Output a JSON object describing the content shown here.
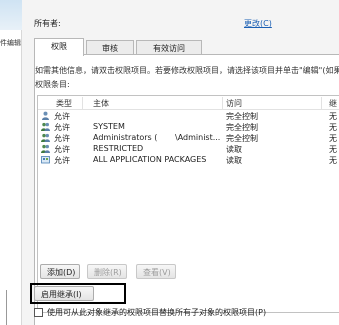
{
  "left_panel": {
    "fragment": "件编辑"
  },
  "owner": {
    "label": "所有者:",
    "change_link": "更改(C)"
  },
  "tabs": [
    {
      "label": "权限",
      "active": true
    },
    {
      "label": "审核",
      "active": false
    },
    {
      "label": "有效访问",
      "active": false
    }
  ],
  "permissions": {
    "description": "如需其他信息，请双击权限项目。若要修改权限项目，请选择该项目并单击\"编辑\"(如果",
    "entries_label": "权限条目:",
    "columns": {
      "type": "类型",
      "principal": "主体",
      "access": "访问",
      "inherited": "继"
    },
    "rows": [
      {
        "icon": "user-icon",
        "type": "允许",
        "principal": "",
        "access": "完全控制",
        "inherited": "无"
      },
      {
        "icon": "group-icon",
        "type": "允许",
        "principal": "SYSTEM",
        "access": "完全控制",
        "inherited": "无"
      },
      {
        "icon": "group-icon",
        "type": "允许",
        "principal": "Administrators (",
        "principal_suffix": "\\Administ...",
        "access": "完全控制",
        "inherited": "无"
      },
      {
        "icon": "group-icon",
        "type": "允许",
        "principal": "RESTRICTED",
        "access": "读取",
        "inherited": "无"
      },
      {
        "icon": "packages-icon",
        "type": "允许",
        "principal": "ALL APPLICATION PACKAGES",
        "access": "读取",
        "inherited": "无"
      }
    ]
  },
  "buttons": {
    "add": "添加(D)",
    "remove": "删除(R)",
    "view": "查看(V)",
    "enable_inheritance": "启用继承(I)"
  },
  "replace_checkbox": {
    "label": "使用可从此对象继承的权限项目替换所有子对象的权限项目(P)",
    "checked": false
  }
}
